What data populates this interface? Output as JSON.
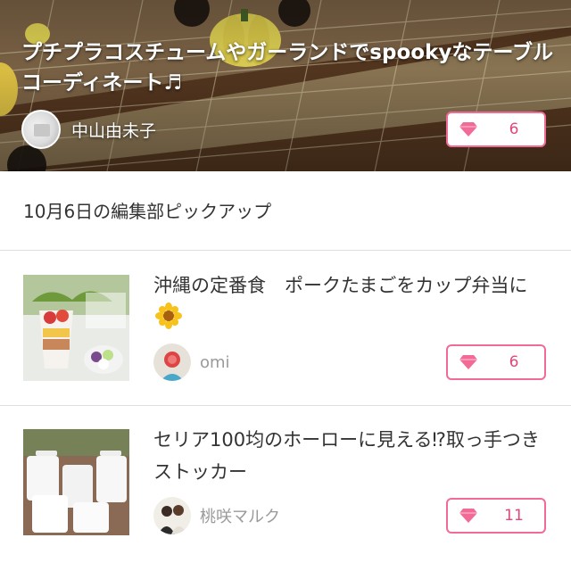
{
  "hero": {
    "title": "プチプラコスチュームやガーランドでspookyなテーブルコーディネート♬",
    "author_name": "中山由未子",
    "like_count": "6",
    "like_icon": "diamond-icon"
  },
  "section": {
    "title": "10月6日の編集部ピックアップ"
  },
  "articles": [
    {
      "title": "沖縄の定番食　ポークたまごをカップ弁当に",
      "title_emoji": "sunflower-icon",
      "author_name": "omi",
      "like_count": "6"
    },
    {
      "title": "セリア100均のホーローに見える⁉︎取っ手つきストッカー",
      "author_name": "桃咲マルク",
      "like_count": "11"
    }
  ],
  "colors": {
    "accent_pink": "#f26b97",
    "accent_pink_text": "#e0477b",
    "divider": "#dedede",
    "muted_text": "#9a9a9a"
  }
}
